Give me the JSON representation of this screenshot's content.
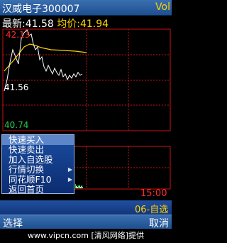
{
  "header": {
    "title": "汉威电子300007",
    "right": "Vol"
  },
  "quote": {
    "latest_label": "最新:",
    "latest_value": "41.58",
    "avg_label": "均价:",
    "avg_value": "41.94"
  },
  "chart": {
    "high_label": "42.13",
    "mid_label": "41.56",
    "low_label": "40.74",
    "colors": {
      "price": "#ffffff",
      "avg": "#ffd200",
      "grid": "#c81414",
      "high": "#ff2a2a",
      "low": "#23d04f"
    }
  },
  "volume": {
    "time_label": "15:00"
  },
  "ticker": {
    "text": "06-自选"
  },
  "menu": {
    "items": [
      {
        "label": "快速买入",
        "has_submenu": false,
        "selected": true
      },
      {
        "label": "快速卖出",
        "has_submenu": false,
        "selected": false
      },
      {
        "label": "加入自选股",
        "has_submenu": false,
        "selected": false
      },
      {
        "label": "行情切换",
        "has_submenu": true,
        "selected": false
      },
      {
        "label": "同花顺F10",
        "has_submenu": true,
        "selected": false
      },
      {
        "label": "返回首页",
        "has_submenu": false,
        "selected": false
      }
    ]
  },
  "softkeys": {
    "left": "选择",
    "right": "取消"
  },
  "footer": {
    "text": "www.vipcn.com [清风网络]提供"
  }
}
